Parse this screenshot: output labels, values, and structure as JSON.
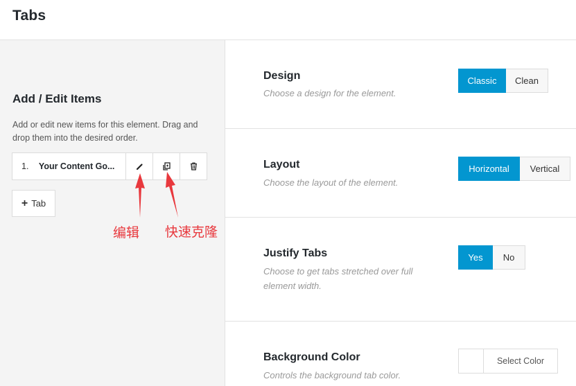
{
  "header": {
    "title": "Tabs"
  },
  "left": {
    "title": "Add / Edit Items",
    "description": "Add or edit new items for this element. Drag and drop them into the desired order.",
    "items": [
      {
        "number": "1.",
        "name": "Your Content Go..."
      }
    ],
    "add_button_label": "Tab",
    "annotations": {
      "edit": "编辑",
      "clone": "快速克隆"
    },
    "annotation_color": "#e8383d"
  },
  "options": {
    "design": {
      "label": "Design",
      "desc": "Choose a design for the element.",
      "buttons": [
        "Classic",
        "Clean"
      ],
      "selected": "Classic"
    },
    "layout": {
      "label": "Layout",
      "desc": "Choose the layout of the element.",
      "buttons": [
        "Horizontal",
        "Vertical"
      ],
      "selected": "Horizontal"
    },
    "justify": {
      "label": "Justify Tabs",
      "desc": "Choose to get tabs stretched over full element width.",
      "buttons": [
        "Yes",
        "No"
      ],
      "selected": "Yes"
    },
    "bg_color": {
      "label": "Background Color",
      "desc": "Controls the background tab color.",
      "button_label": "Select Color"
    }
  },
  "accent_color": "#0396d0"
}
